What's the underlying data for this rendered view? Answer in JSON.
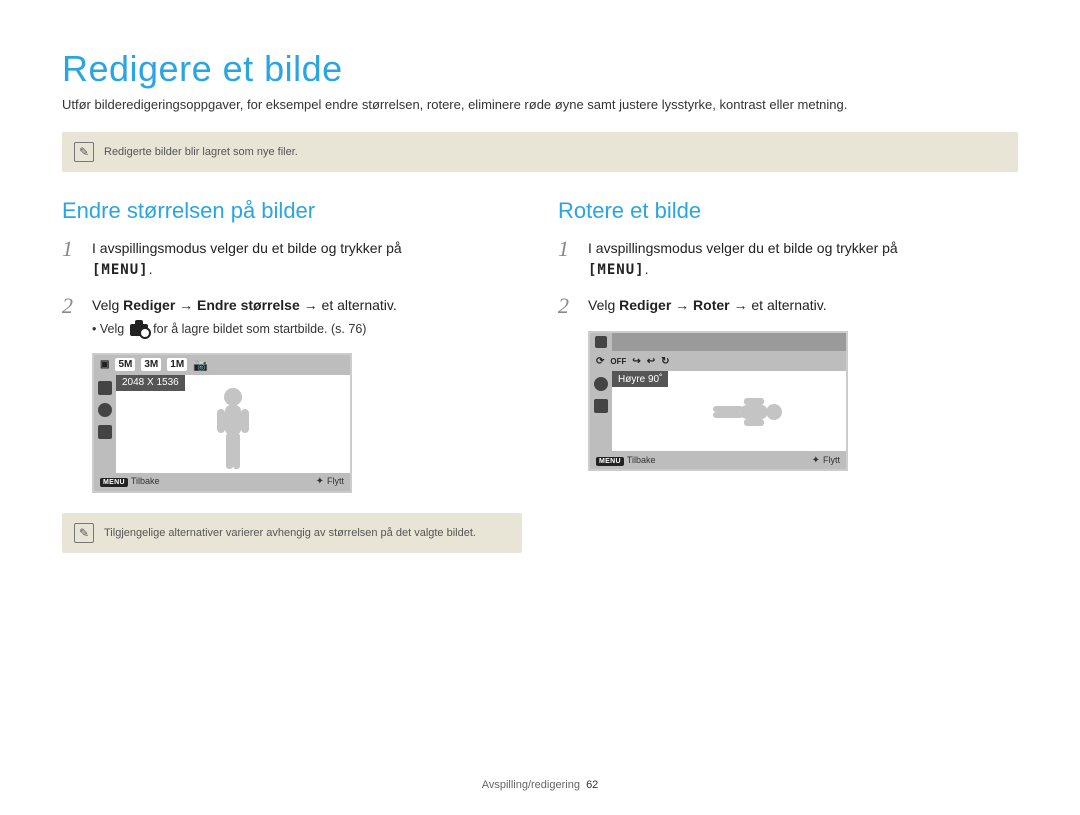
{
  "page_title": "Redigere et bilde",
  "intro": "Utfør bilderedigeringsoppgaver, for eksempel endre størrelsen, rotere, eliminere røde øyne samt justere lysstyrke, kontrast eller metning.",
  "top_note": "Redigerte bilder blir lagret som nye filer.",
  "left": {
    "heading": "Endre størrelsen på bilder",
    "step1": {
      "num": "1",
      "text": "I avspillingsmodus velger du et bilde og trykker på",
      "menu_key": "[MENU]",
      "suffix": "."
    },
    "step2": {
      "num": "2",
      "prefix": "Velg ",
      "bold1": "Rediger",
      "arrow1": " → ",
      "bold2": "Endre størrelse",
      "arrow2": " → ",
      "suffix": "et alternativ.",
      "sub_prefix": "Velg ",
      "sub_suffix": " for å lagre bildet som startbilde. (s. 76)"
    },
    "lcd": {
      "icons": [
        "5M",
        "3M",
        "1M"
      ],
      "tooltip": "2048 X 1536",
      "back_key": "MENU",
      "back_label": "Tilbake",
      "move_label": "Flytt"
    },
    "sub_note": "Tilgjengelige alternativer varierer avhengig av størrelsen på det valgte bildet."
  },
  "right": {
    "heading": "Rotere et bilde",
    "step1": {
      "num": "1",
      "text": "I avspillingsmodus velger du et bilde og trykker på",
      "menu_key": "[MENU]",
      "suffix": "."
    },
    "step2": {
      "num": "2",
      "prefix": "Velg ",
      "bold1": "Rediger",
      "arrow1": " → ",
      "bold2": "Roter",
      "arrow2": " → ",
      "suffix": "et alternativ."
    },
    "lcd": {
      "icons_label": "OFF",
      "tooltip": "Høyre 90˚",
      "back_key": "MENU",
      "back_label": "Tilbake",
      "move_label": "Flytt"
    }
  },
  "footer": {
    "section": "Avspilling/redigering",
    "page": "62"
  }
}
